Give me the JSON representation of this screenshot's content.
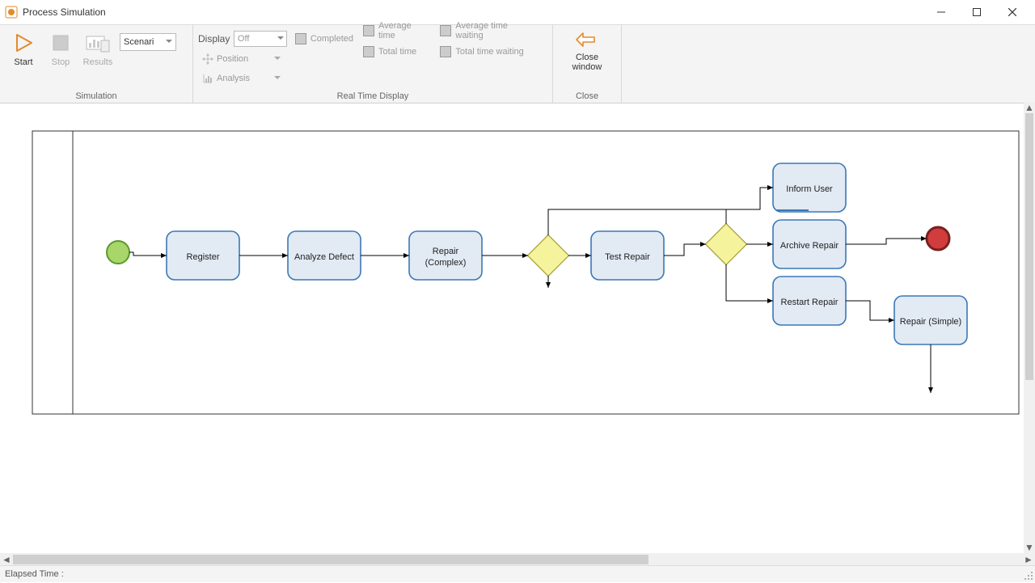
{
  "window": {
    "title": "Process Simulation"
  },
  "ribbon": {
    "simulation": {
      "label": "Simulation",
      "start": "Start",
      "stop": "Stop",
      "results": "Results",
      "scenario_value": "Scenari"
    },
    "realtime": {
      "label": "Real Time Display",
      "display_label": "Display",
      "display_value": "Off",
      "position": "Position",
      "analysis": "Analysis",
      "checks": {
        "completed": "Completed",
        "avg_time": "Average time",
        "avg_wait": "Average time waiting",
        "total_time": "Total time",
        "total_wait": "Total time waiting"
      }
    },
    "close": {
      "label": "Close",
      "button_line1": "Close",
      "button_line2": "window"
    }
  },
  "diagram": {
    "tasks": {
      "register": "Register",
      "analyze": "Analyze Defect",
      "repair_complex_l1": "Repair",
      "repair_complex_l2": "(Complex)",
      "test_repair": "Test Repair",
      "inform_user": "Inform User",
      "archive_repair": "Archive Repair",
      "restart_repair": "Restart Repair",
      "repair_simple": "Repair (Simple)"
    }
  },
  "status": {
    "elapsed": "Elapsed Time :"
  }
}
